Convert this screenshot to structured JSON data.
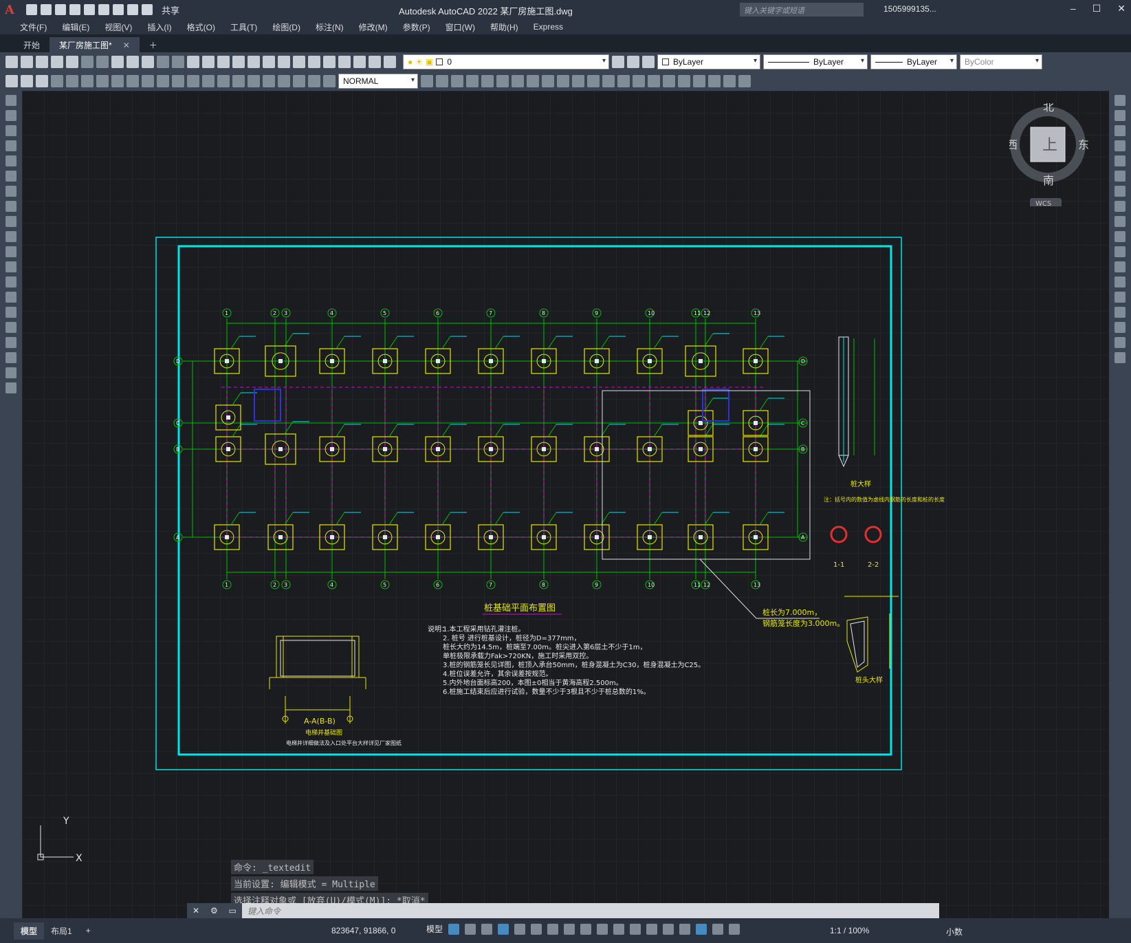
{
  "app": {
    "logo": "A",
    "title": "Autodesk AutoCAD 2022    某厂房施工图.dwg",
    "share": "共享",
    "search_placeholder": "键入关键字或短语",
    "user": "1505999135...",
    "window_buttons": [
      "–",
      "☐",
      "✕"
    ]
  },
  "menu": [
    "文件(F)",
    "编辑(E)",
    "视图(V)",
    "插入(I)",
    "格式(O)",
    "工具(T)",
    "绘图(D)",
    "标注(N)",
    "修改(M)",
    "参数(P)",
    "窗口(W)",
    "帮助(H)",
    "Express"
  ],
  "tabs": [
    {
      "label": "开始"
    },
    {
      "label": "某厂房施工图*"
    }
  ],
  "toolbar": {
    "layer_value": "0",
    "color_value": "ByLayer",
    "linetype_value": "ByLayer",
    "lineweight_value": "ByLayer",
    "plotstyle_value": "ByColor",
    "dimstyle_value": "NORMAL"
  },
  "viewcube": {
    "north": "北",
    "south": "南",
    "east": "东",
    "west": "西",
    "face": "上",
    "wcs": "WCS"
  },
  "drawing": {
    "title": "桩基础平面布置图",
    "notes_title": "说明：",
    "notes": [
      "1.本工程采用钻孔灌注桩。",
      "2.            桩号               进行桩基设计，桩径为D=377mm，",
      "  桩长大约为14.5m，桩端至7.00m。桩尖进入第6层土不少于1m，",
      "  单桩极限承载力Fak>720KN，施工时采用双控。",
      "3.桩的钢筋笼长见详图，桩顶入承台50mm，桩身混凝土为C30，桩身混凝土为C25。",
      "4.桩位误差允许，其余误差按规范。",
      "5.内外地台面标高200，本图±0相当于黄海高程2.500m。",
      "6.桩施工结束后应进行试验，数量不少于3根且不少于桩总数的1%。"
    ],
    "axis_top": [
      "1",
      "2",
      "3",
      "4",
      "5",
      "6",
      "7",
      "8",
      "9",
      "10",
      "11",
      "12",
      "13"
    ],
    "axis_left": [
      "D",
      "C",
      "B",
      "A"
    ],
    "section_aa": "A-A(B-B)",
    "section_aa_sub": "电梯井基础图",
    "section_aa_note": "电梯井详细做法及入口处平台大样详见厂家图纸",
    "pile_detail": "桩大样",
    "pile_head_detail": "桩头大样",
    "sec11": "1-1",
    "sec22": "2-2",
    "leader_text1": "桩长为7.000m，",
    "leader_text2": "钢筋笼长度为3.000m。",
    "pile_note": "注：括号内的数值为虚线内钢筋的长度和桩的长度"
  },
  "command": {
    "history": [
      "命令: _textedit",
      "当前设置: 编辑模式 = Multiple",
      "选择注释对象或 [放弃(U)/模式(M)]: *取消*"
    ],
    "placeholder": "键入命令"
  },
  "status": {
    "layout_tabs": [
      "模型",
      "布局1",
      "+"
    ],
    "coords": "823647, 91866, 0",
    "model": "模型",
    "scale": "1:1 / 100%",
    "units": "小数"
  },
  "ucs": {
    "x": "X",
    "y": "Y"
  },
  "colors": {
    "canvas": "#1a1c20",
    "frame": "#00e5e5",
    "axis": "#00c000",
    "pile": "#e8e800",
    "dashed": "#e000e0"
  }
}
